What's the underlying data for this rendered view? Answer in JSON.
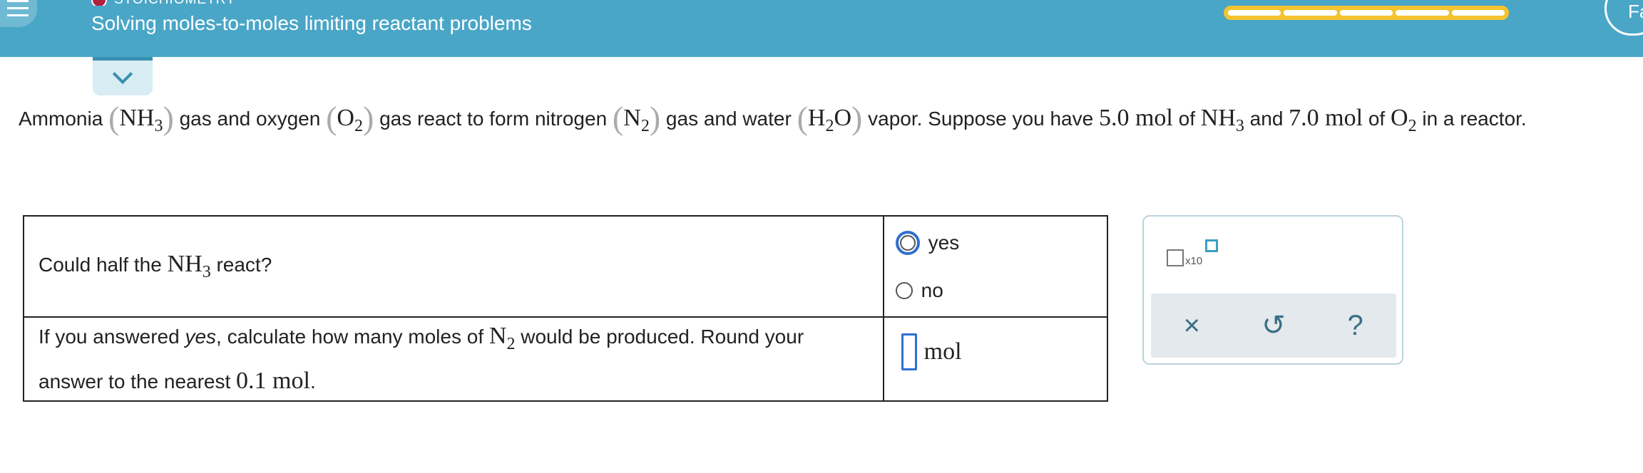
{
  "header": {
    "topic": "STOICHIOMETRY",
    "title": "Solving moles-to-moles limiting reactant problems",
    "progress_segments": 5,
    "corner_label": "Fa",
    "menu_icon": "hamburger-icon"
  },
  "problem": {
    "s1": "Ammonia ",
    "nh3": "NH",
    "three": "3",
    "s2": " gas and oxygen ",
    "o2": "O",
    "two": "2",
    "s3": " gas react to form nitrogen ",
    "n2": "N",
    "s4": " gas and water ",
    "h2o_h": "H",
    "h2o_o": "O",
    "s5": " vapor. Suppose you have ",
    "amt1": "5.0 mol",
    "of": " of ",
    "and": " and ",
    "amt2": "7.0 mol",
    "s6": " in a reactor.",
    "lparen": "(",
    "rparen": ")"
  },
  "table": {
    "q1_a": "Could half the ",
    "q1_b": " react?",
    "opt_yes": "yes",
    "opt_no": "no",
    "q2_a": "If you answered ",
    "q2_yes": "yes",
    "q2_b": ", calculate how many moles of ",
    "q2_c": " would be produced. Round your answer to the nearest ",
    "q2_val": "0.1 mol",
    "q2_end": ".",
    "unit": "mol"
  },
  "tools": {
    "x10": "x10",
    "clear": "×",
    "undo": "↺",
    "help": "?"
  }
}
